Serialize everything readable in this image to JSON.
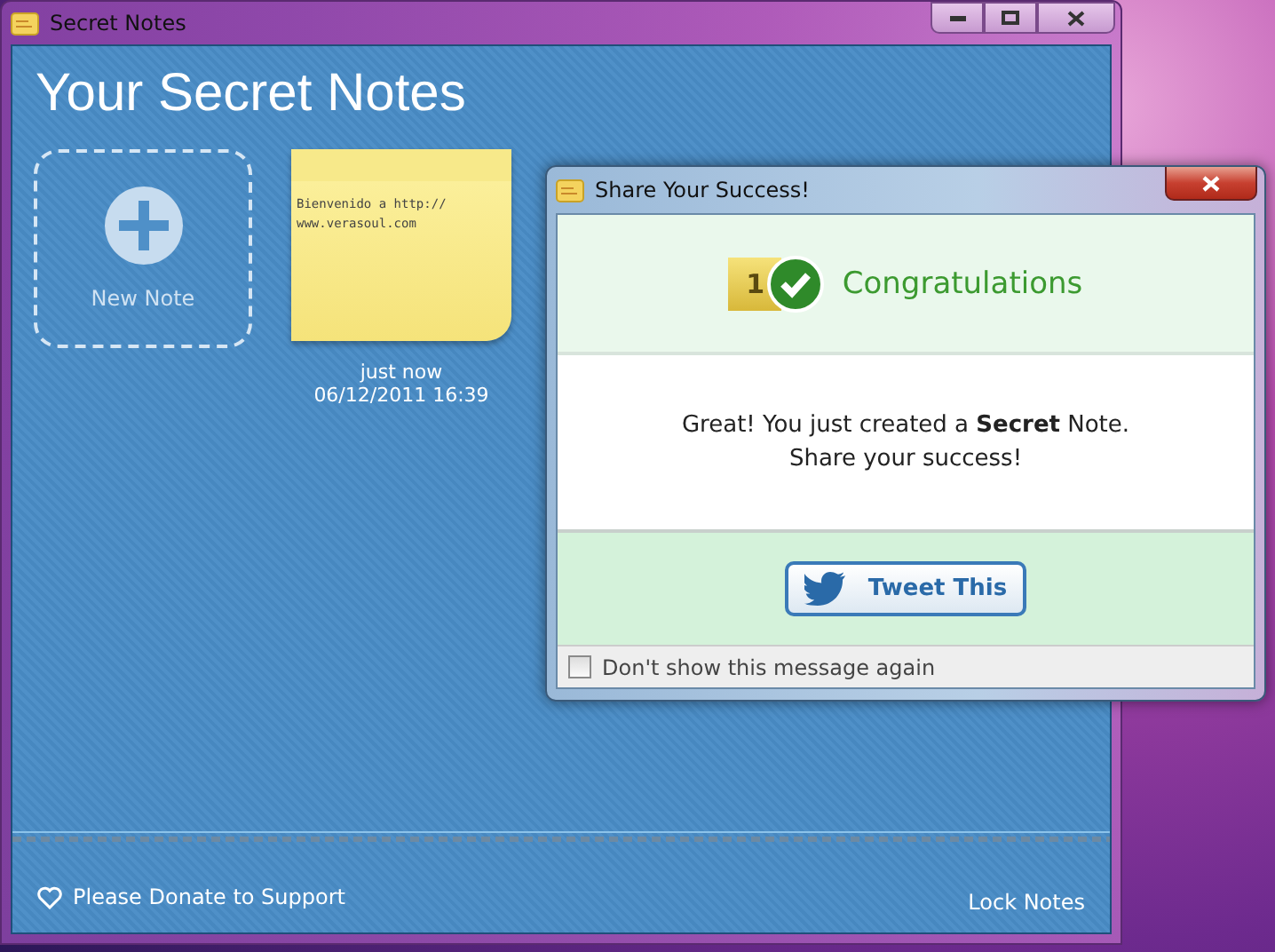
{
  "main_window": {
    "title": "Secret Notes",
    "heading": "Your Secret Notes",
    "new_note": {
      "label": "New Note"
    },
    "notes": [
      {
        "text": "Bienvenido a http:// www.verasoul.com",
        "time": "just now",
        "date": "06/12/2011 16:39"
      }
    ],
    "footer": {
      "donate": "Please Donate to Support",
      "lock": "Lock Notes"
    }
  },
  "dialog": {
    "title": "Share Your Success!",
    "badge": "1",
    "heading": "Congratulations",
    "message": [
      "Great! You just created a **Secret** Note.",
      "Share your success!"
    ],
    "tweet_button": "Tweet This",
    "dont_show": {
      "label": "Don't show this message again",
      "checked": false
    }
  }
}
